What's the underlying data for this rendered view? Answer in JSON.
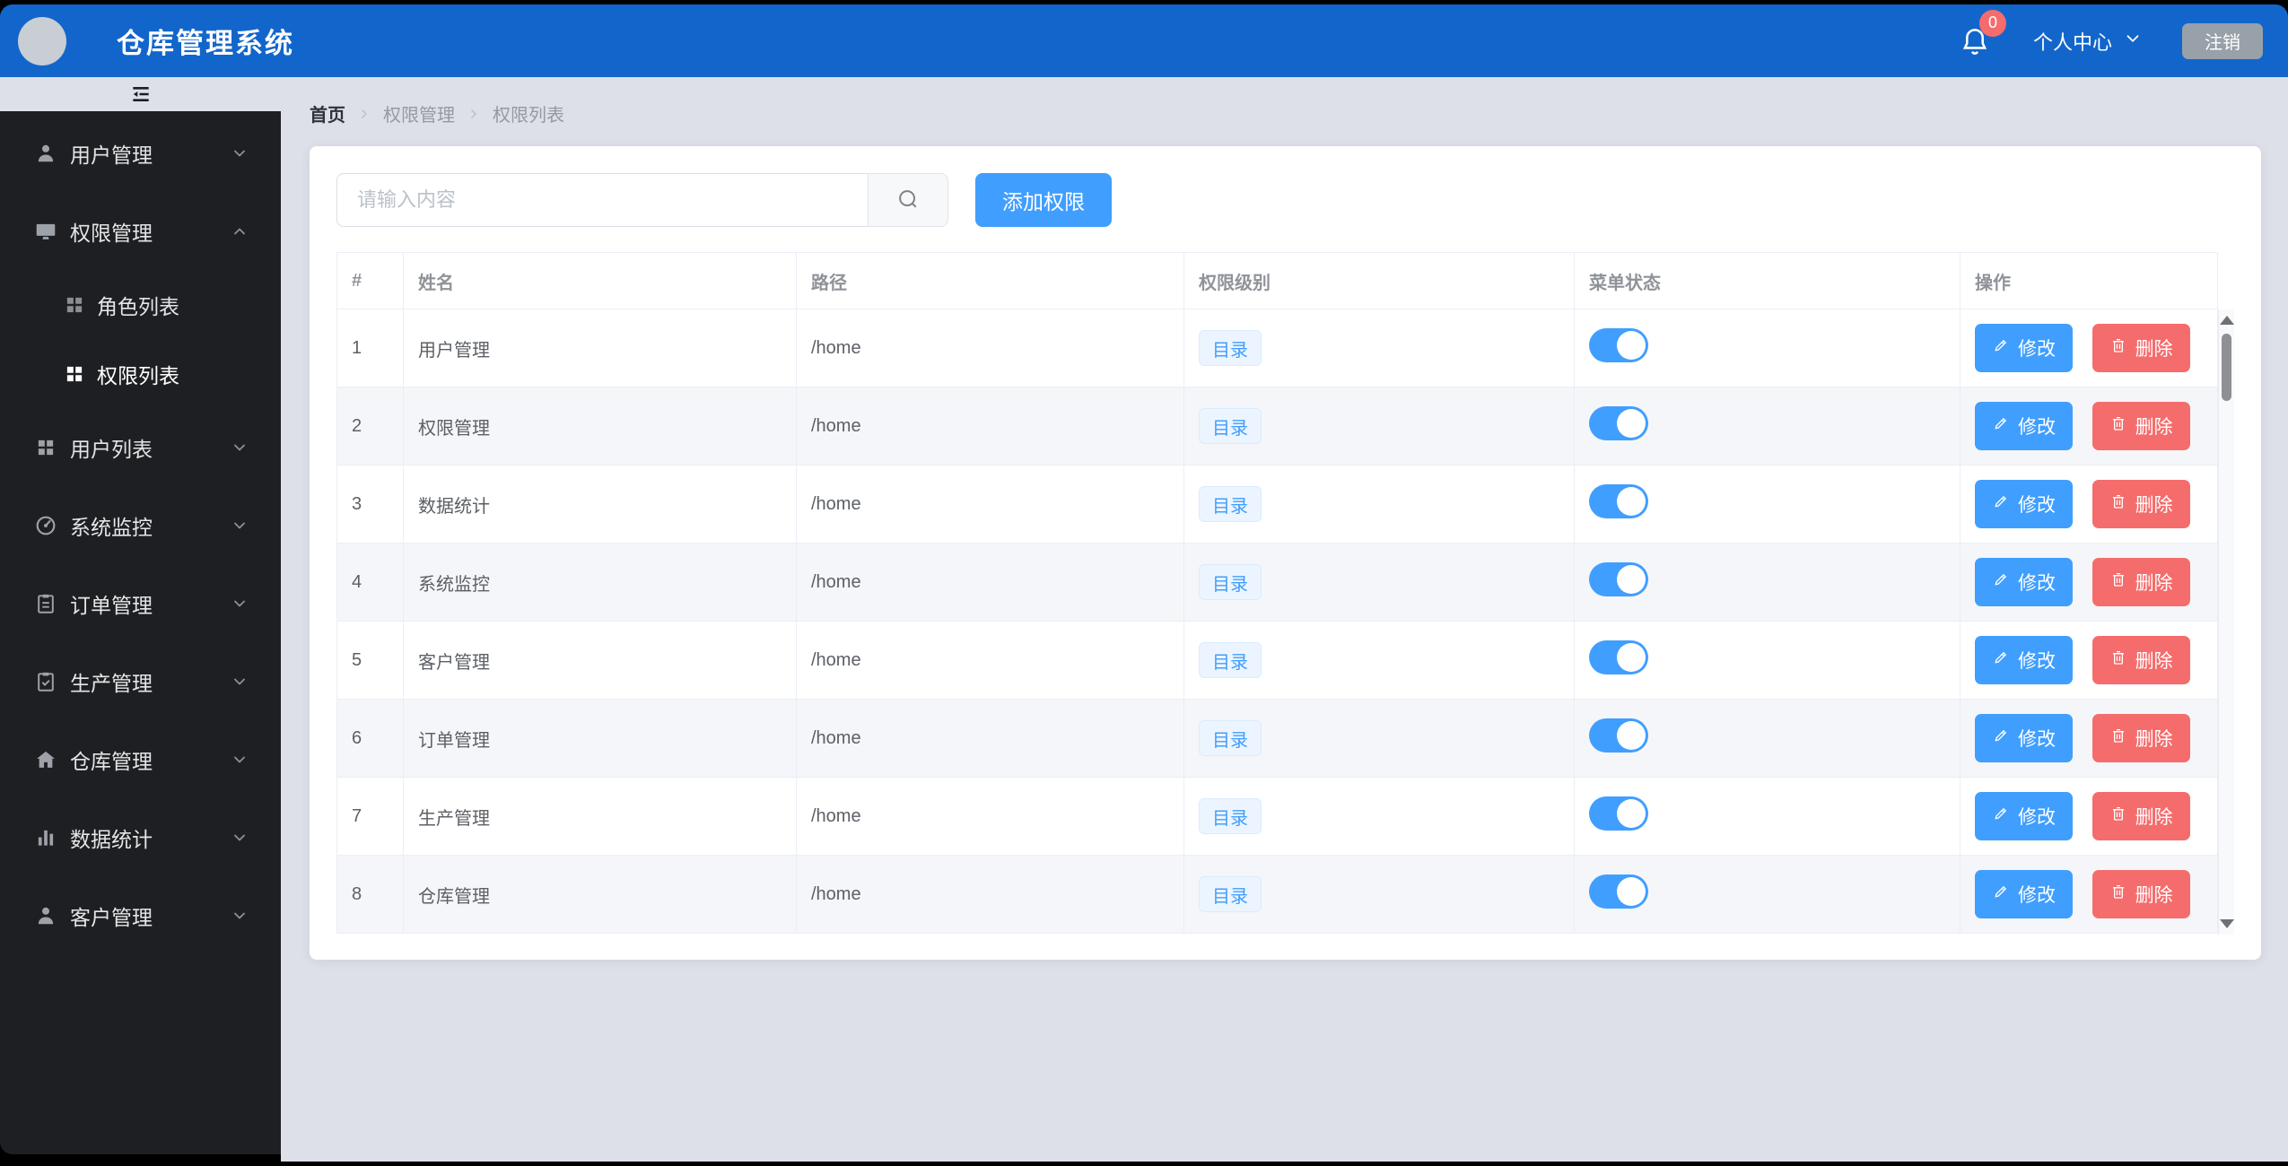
{
  "app": {
    "title": "仓库管理系统",
    "badge_count": "0",
    "user_center": "个人中心",
    "logout": "注销"
  },
  "sidebar": {
    "items": [
      {
        "label": "用户管理",
        "icon": "user-icon",
        "expanded": false
      },
      {
        "label": "权限管理",
        "icon": "monitor-icon",
        "expanded": true,
        "children": [
          {
            "label": "角色列表",
            "icon": "grid-icon",
            "active": false
          },
          {
            "label": "权限列表",
            "icon": "grid-icon",
            "active": true
          }
        ]
      },
      {
        "label": "用户列表",
        "icon": "grid-icon",
        "expanded": false
      },
      {
        "label": "系统监控",
        "icon": "gauge-icon",
        "expanded": false
      },
      {
        "label": "订单管理",
        "icon": "clipboard-icon",
        "expanded": false
      },
      {
        "label": "生产管理",
        "icon": "clipboard-check-icon",
        "expanded": false
      },
      {
        "label": "仓库管理",
        "icon": "home-icon",
        "expanded": false
      },
      {
        "label": "数据统计",
        "icon": "bar-chart-icon",
        "expanded": false
      },
      {
        "label": "客户管理",
        "icon": "person-icon",
        "expanded": false
      }
    ]
  },
  "breadcrumb": [
    "首页",
    "权限管理",
    "权限列表"
  ],
  "toolbar": {
    "search_placeholder": "请输入内容",
    "add_button": "添加权限"
  },
  "table": {
    "headers": [
      "#",
      "姓名",
      "路径",
      "权限级别",
      "菜单状态",
      "操作"
    ],
    "edit_label": "修改",
    "delete_label": "删除",
    "rows": [
      {
        "index": 1,
        "name": "用户管理",
        "path": "/home",
        "level": "目录",
        "enabled": true
      },
      {
        "index": 2,
        "name": "权限管理",
        "path": "/home",
        "level": "目录",
        "enabled": true
      },
      {
        "index": 3,
        "name": "数据统计",
        "path": "/home",
        "level": "目录",
        "enabled": true
      },
      {
        "index": 4,
        "name": "系统监控",
        "path": "/home",
        "level": "目录",
        "enabled": true
      },
      {
        "index": 5,
        "name": "客户管理",
        "path": "/home",
        "level": "目录",
        "enabled": true
      },
      {
        "index": 6,
        "name": "订单管理",
        "path": "/home",
        "level": "目录",
        "enabled": true
      },
      {
        "index": 7,
        "name": "生产管理",
        "path": "/home",
        "level": "目录",
        "enabled": true
      },
      {
        "index": 8,
        "name": "仓库管理",
        "path": "/home",
        "level": "目录",
        "enabled": true
      }
    ]
  },
  "colors": {
    "header_blue": "#1266cb",
    "primary_blue": "#409eff",
    "danger_red": "#f56c6c",
    "sidebar_bg": "#1e1f22",
    "page_bg": "#dde0e8",
    "tag_bg": "#ecf5ff",
    "tag_text": "#409eff"
  }
}
